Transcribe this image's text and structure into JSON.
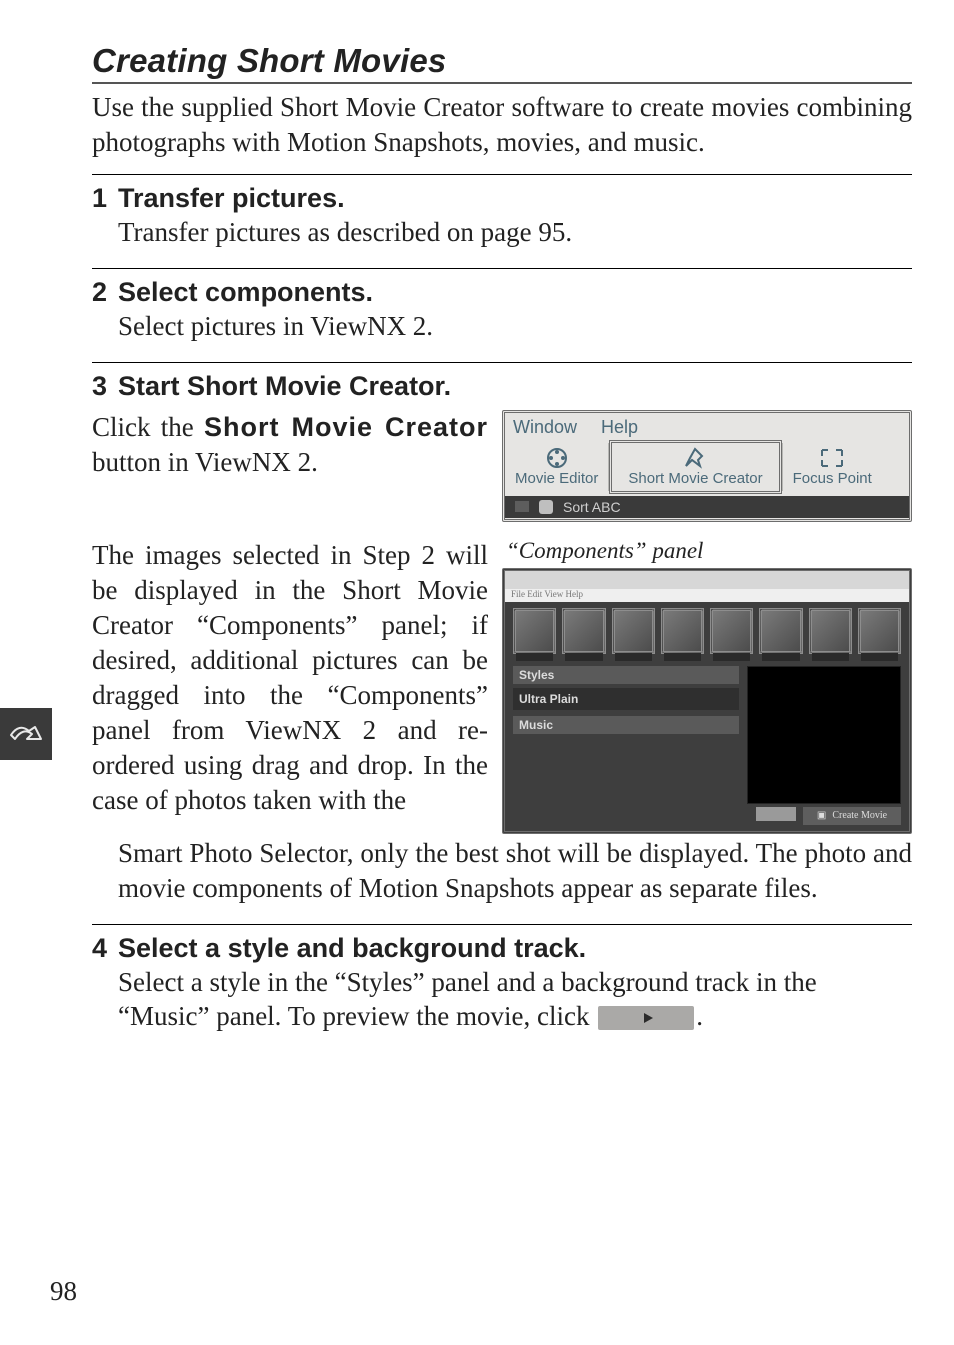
{
  "page_number": "98",
  "heading": "Creating Short Movies",
  "intro": "Use the supplied Short Movie Creator software to create movies combining photographs with Motion Snapshots, movies, and music.",
  "steps": {
    "s1": {
      "num": "1",
      "title": "Transfer pictures.",
      "desc": "Transfer pictures as described on page 95."
    },
    "s2": {
      "num": "2",
      "title": "Select components.",
      "desc": "Select pictures in ViewNX 2."
    },
    "s3": {
      "num": "3",
      "title": "Start Short Movie Creator.",
      "desc_pre": "Click the ",
      "desc_strong": "Short Movie Creator",
      "desc_post": " button in ViewNX 2.",
      "para2": "The images selected in Step 2 will be displayed in the Short Movie Creator “Components” panel; if desired, additional pictures can be dragged into the “Components” panel from ViewNX 2 and re-ordered using drag and drop. In the case of photos taken with the",
      "after": "Smart Photo Selector, only the best shot will be displayed. The photo and movie components of Motion Snapshots appear as separate files."
    },
    "s4": {
      "num": "4",
      "title": "Select a style and background track.",
      "desc_pre": "Select a style in the “Styles” panel and a background track in the “Music” panel. To preview the movie, click ",
      "desc_post": "."
    }
  },
  "toolbar": {
    "menu": {
      "window": "Window",
      "help": "Help"
    },
    "left_label": "Movie Editor",
    "center_label": "Short Movie Creator",
    "right_label": "Focus Point",
    "row2": "Sort ABC"
  },
  "components_panel": {
    "caption": "“Components” panel",
    "styles_label": "Styles",
    "ultra_plain_title": "Ultra Plain",
    "music_label": "Music",
    "create_movie": "Create Movie"
  },
  "icons": {
    "side_tab": "connection-arrow-icon"
  }
}
